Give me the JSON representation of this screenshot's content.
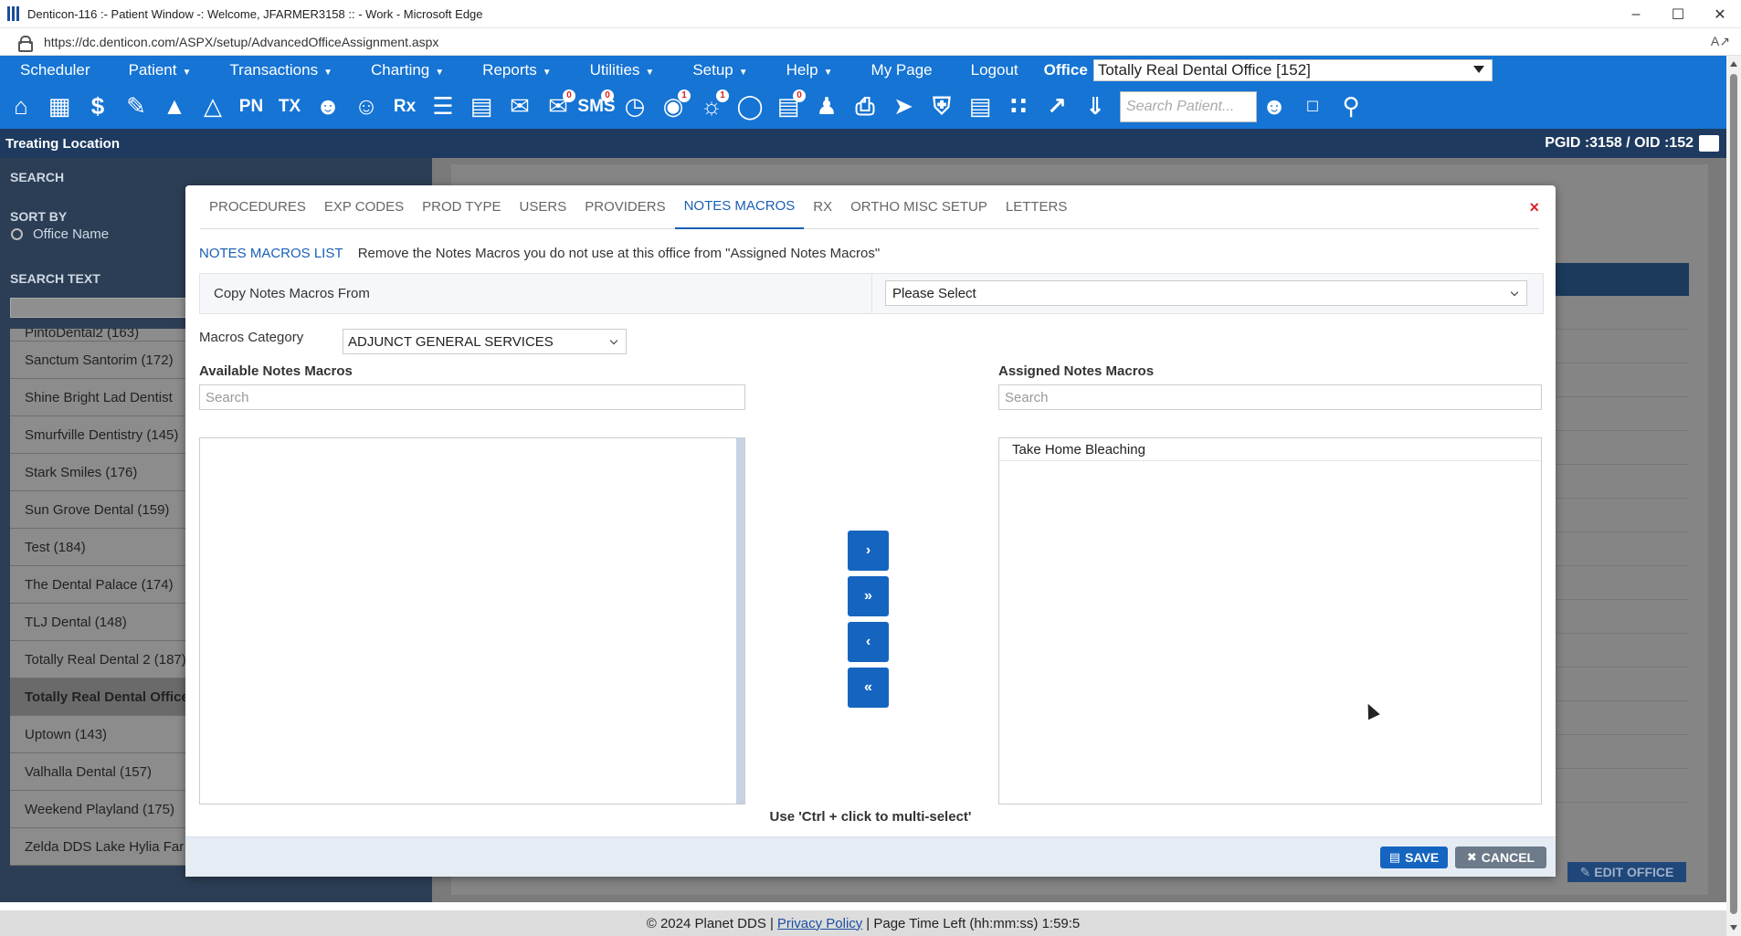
{
  "window": {
    "title": "Denticon-116 :- Patient Window -: Welcome, JFARMER3158 :: - Work - Microsoft Edge",
    "url": "https://dc.denticon.com/ASPX/setup/AdvancedOfficeAssignment.aspx"
  },
  "menu": {
    "items": [
      "Scheduler",
      "Patient",
      "Transactions",
      "Charting",
      "Reports",
      "Utilities",
      "Setup",
      "Help",
      "My Page",
      "Logout"
    ],
    "office_label": "Office",
    "office_value": "Totally Real Dental Office [152]"
  },
  "toolbar": {
    "search_placeholder": "Search Patient...",
    "badges": {
      "messages": "0",
      "sms": "0",
      "online": "1",
      "alerts": "1",
      "forms": "0"
    },
    "text_icons": {
      "pn": "PN",
      "tx": "TX",
      "rx": "Rx",
      "sms": "SMS"
    }
  },
  "location_bar": {
    "title": "Treating Location",
    "ids": "PGID :3158  /  OID :152"
  },
  "sidebar": {
    "search_header": "SEARCH",
    "sort_by_label": "SORT BY",
    "sort_option": "Office Name",
    "search_text_label": "SEARCH TEXT",
    "offices": [
      "PintoDental2 (163)",
      "Sanctum Santorim (172)",
      "Shine Bright Lad Dentist",
      "Smurfville Dentistry (145)",
      "Stark Smiles (176)",
      "Sun Grove Dental (159)",
      "Test (184)",
      "The Dental Palace (174)",
      "TLJ Dental (148)",
      "Totally Real Dental 2 (187)",
      "Totally Real Dental Office",
      "Uptown (143)",
      "Valhalla Dental (157)",
      "Weekend Playland (175)",
      "Zelda DDS Lake Hylia Far"
    ],
    "selected_office": "Totally Real Dental Office"
  },
  "background_page": {
    "edit_office_label": "EDIT OFFICE"
  },
  "modal": {
    "tabs": [
      "PROCEDURES",
      "EXP CODES",
      "PROD TYPE",
      "USERS",
      "PROVIDERS",
      "NOTES MACROS",
      "RX",
      "ORTHO MISC SETUP",
      "LETTERS"
    ],
    "active_tab": "NOTES MACROS",
    "list_label": "NOTES MACROS LIST",
    "list_description": "Remove the Notes Macros you do not use at this office from \"Assigned Notes Macros\"",
    "copy_from_label": "Copy Notes Macros From",
    "copy_from_value": "Please Select",
    "category_label": "Macros Category",
    "category_value": "ADJUNCT GENERAL SERVICES",
    "available_label": "Available Notes Macros",
    "available_search_placeholder": "Search",
    "available_items": [],
    "assigned_label": "Assigned Notes Macros",
    "assigned_search_placeholder": "Search",
    "assigned_items": [
      "Take Home Bleaching"
    ],
    "move_buttons": [
      "›",
      "»",
      "‹",
      "«"
    ],
    "hint": "Use 'Ctrl + click to multi-select'",
    "save_label": "SAVE",
    "cancel_label": "CANCEL",
    "close_glyph": "×"
  },
  "footer": {
    "copyright": "© 2024 Planet DDS |",
    "privacy": "Privacy Policy",
    "time_left": "| Page Time Left (hh:mm:ss) 1:59:5"
  },
  "colors": {
    "brand_blue": "#1574d4",
    "nav_dark": "#1e3a5f",
    "accent": "#1a5fb4",
    "close_red": "#d9262c"
  }
}
